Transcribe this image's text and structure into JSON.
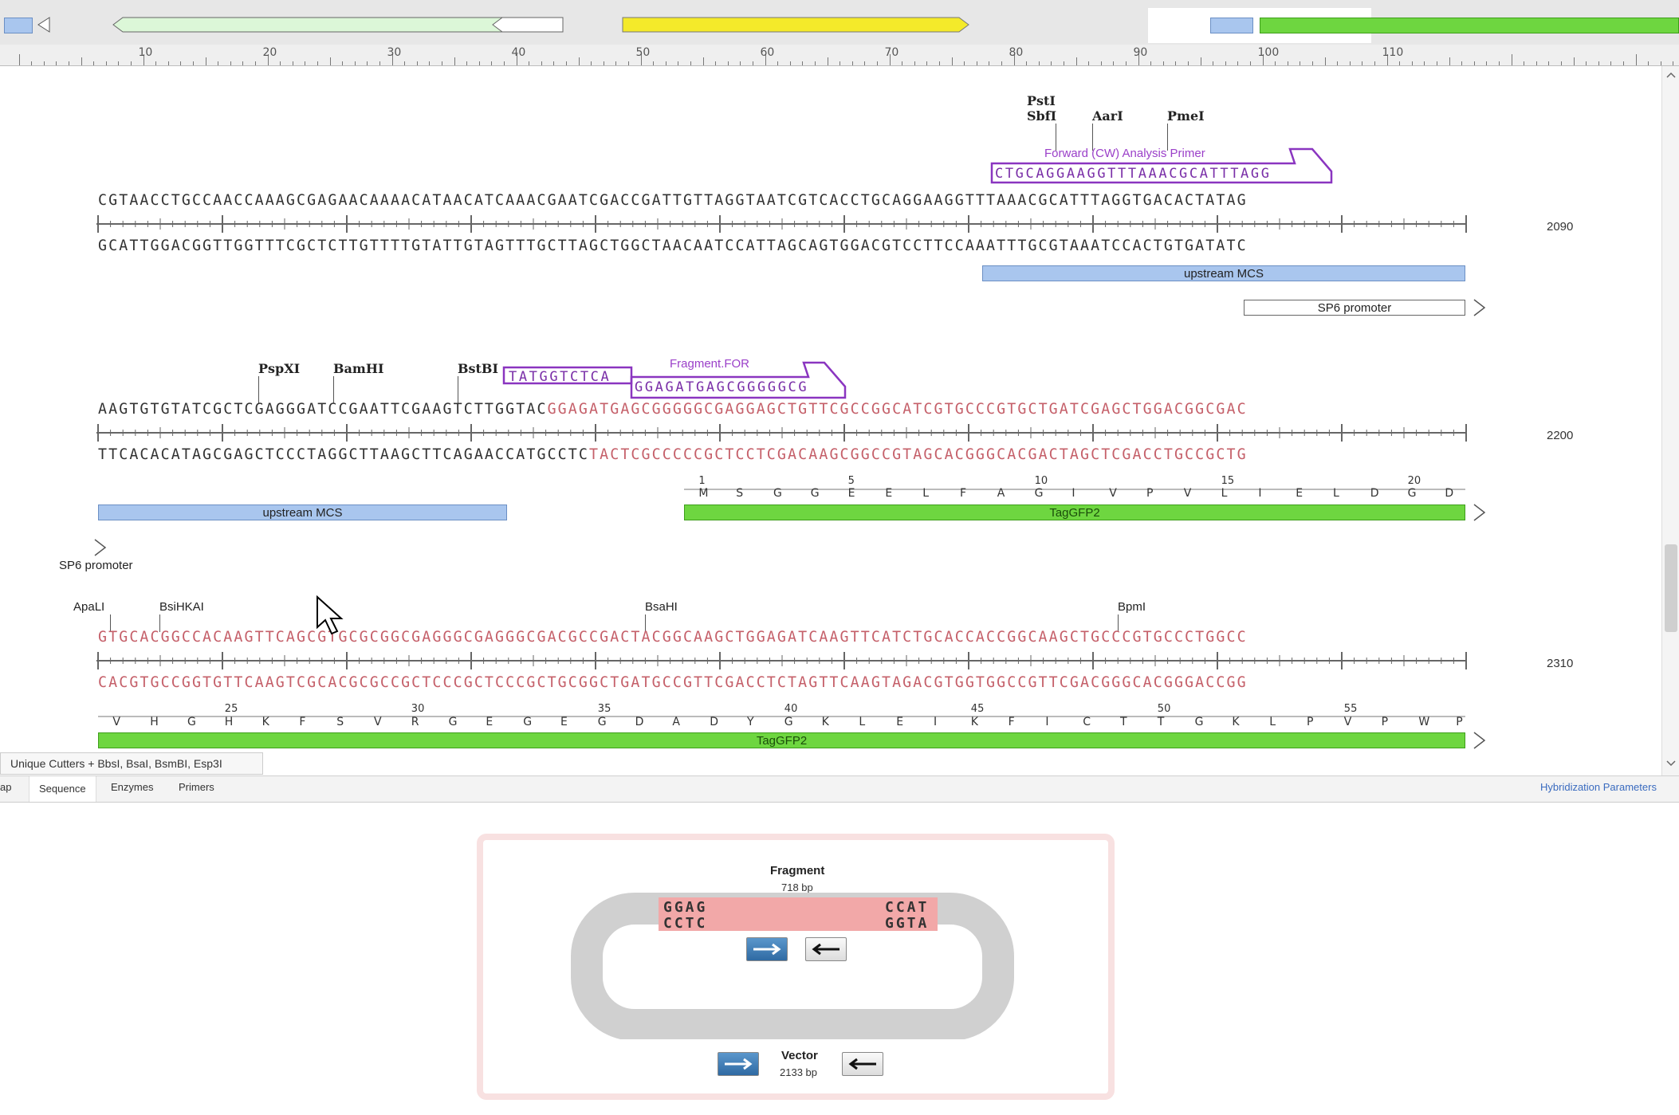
{
  "colors": {
    "accent_blue": "#a9c6ee",
    "feature_green": "#6ed640",
    "primer_purple": "#9b40c9",
    "highlight_pink": "#c5606a",
    "overview_yellow": "#f4ea2a"
  },
  "ruler": {
    "labels": [
      "10",
      "20",
      "30",
      "40",
      "50",
      "60",
      "70",
      "80",
      "90",
      "100",
      "110"
    ]
  },
  "rows": [
    {
      "top_strand": "CGTAACCTGCCAACCAAAGCGAGAACAAAACATAACATCAAACGAATCGACCGATTGTTAGGTAATCGTCACCTGCAGGAAGGTTTAAACGCATTTAGGTGACACTATAG",
      "bottom_strand": "GCATTGGACGGTTGGTTTCGCTCTTGTTTTGTATTGTAGTTTGCTTAGCTGGCTAACAATCCATTAGCAGTGGACGTCCTTCCAAATTTGCGTAAATCCACTGTGATATC",
      "position": "2090",
      "enzymes": [
        "PstI",
        "SbfI",
        "AarI",
        "PmeI"
      ],
      "primer": {
        "label": "Forward (CW) Analysis Primer",
        "sequence": "CTGCAGGAAGGTTTAAACGCATTTAGG"
      },
      "features": [
        "upstream MCS",
        "SP6 promoter"
      ]
    },
    {
      "top_strand_black": "AAGTGTGTATCGCTCGAGGGATCCGAATTCGAAGTCTTGGTAC",
      "top_strand_pink": "GGAGATGAGCGGGGGCGAGGAGCTGTTCGCCGGCATCGTGCCCGTGCTGATCGAGCTGGACGGCGAC",
      "bottom_strand_black": "TTCACACATAGCGAGCTCCCTAGGCTTAAGCTTCAGAACCATGCCTC",
      "bottom_strand_pink": "TACTCGCCCCCGCTCCTCGACAAGCGGCCGTAGCACGGGCACGACTAGCTCGACCTGCCGCTG",
      "position": "2200",
      "enzymes": [
        "PspXI",
        "BamHI",
        "BstBI"
      ],
      "primer": {
        "label": "Fragment.FOR",
        "sequence_part1": "TATGGTCTCA",
        "sequence_part2": "GGAGATGAGCGGGGGCG"
      },
      "aa_numbers": [
        "1",
        "5",
        "10",
        "15",
        "20"
      ],
      "aa": [
        "M",
        "S",
        "G",
        "G",
        "E",
        "E",
        "L",
        "F",
        "A",
        "G",
        "I",
        "V",
        "P",
        "V",
        "L",
        "I",
        "E",
        "L",
        "D",
        "G",
        "D"
      ],
      "features": [
        "upstream MCS",
        "TagGFP2",
        "SP6 promoter"
      ]
    },
    {
      "top_strand": "GTGCACGGCCACAAGTTCAGCGTGCGCGGCGAGGGCGAGGGCGACGCCGACTACGGCAAGCTGGAGATCAAGTTCATCTGCACCACCGGCAAGCTGCCCGTGCCCTGGCC",
      "bottom_strand": "CACGTGCCGGTGTTCAAGTCGCACGCGCCGCTCCCGCTCCCGCTGCGGCTGATGCCGTTCGACCTCTAGTTCAAGTAGACGTGGTGGCCGTTCGACGGGCACGGGACCGG",
      "position": "2310",
      "enzymes": [
        "ApaLI",
        "BsiHKAI",
        "BsaHI",
        "BpmI"
      ],
      "aa_numbers": [
        "25",
        "30",
        "35",
        "40",
        "45",
        "50",
        "55"
      ],
      "aa": [
        "V",
        "H",
        "G",
        "H",
        "K",
        "F",
        "S",
        "V",
        "R",
        "G",
        "E",
        "G",
        "E",
        "G",
        "D",
        "A",
        "D",
        "Y",
        "G",
        "K",
        "L",
        "E",
        "I",
        "K",
        "F",
        "I",
        "C",
        "T",
        "T",
        "G",
        "K",
        "L",
        "P",
        "V",
        "P",
        "W",
        "P"
      ],
      "features": [
        "TagGFP2"
      ]
    }
  ],
  "filter": "Unique Cutters + BbsI, BsaI, BsmBI, Esp3I",
  "tabs": [
    "ap",
    "Sequence",
    "Enzymes",
    "Primers"
  ],
  "hybridization_link": "Hybridization Parameters",
  "overview_panel": {
    "fragment_title": "Fragment",
    "fragment_size": "718 bp",
    "left_overhang_top": "GGAG",
    "left_overhang_bottom": "CCTC",
    "right_overhang_top": "CCAT",
    "right_overhang_bottom": "GGTA",
    "vector_title": "Vector",
    "vector_size": "2133 bp"
  }
}
